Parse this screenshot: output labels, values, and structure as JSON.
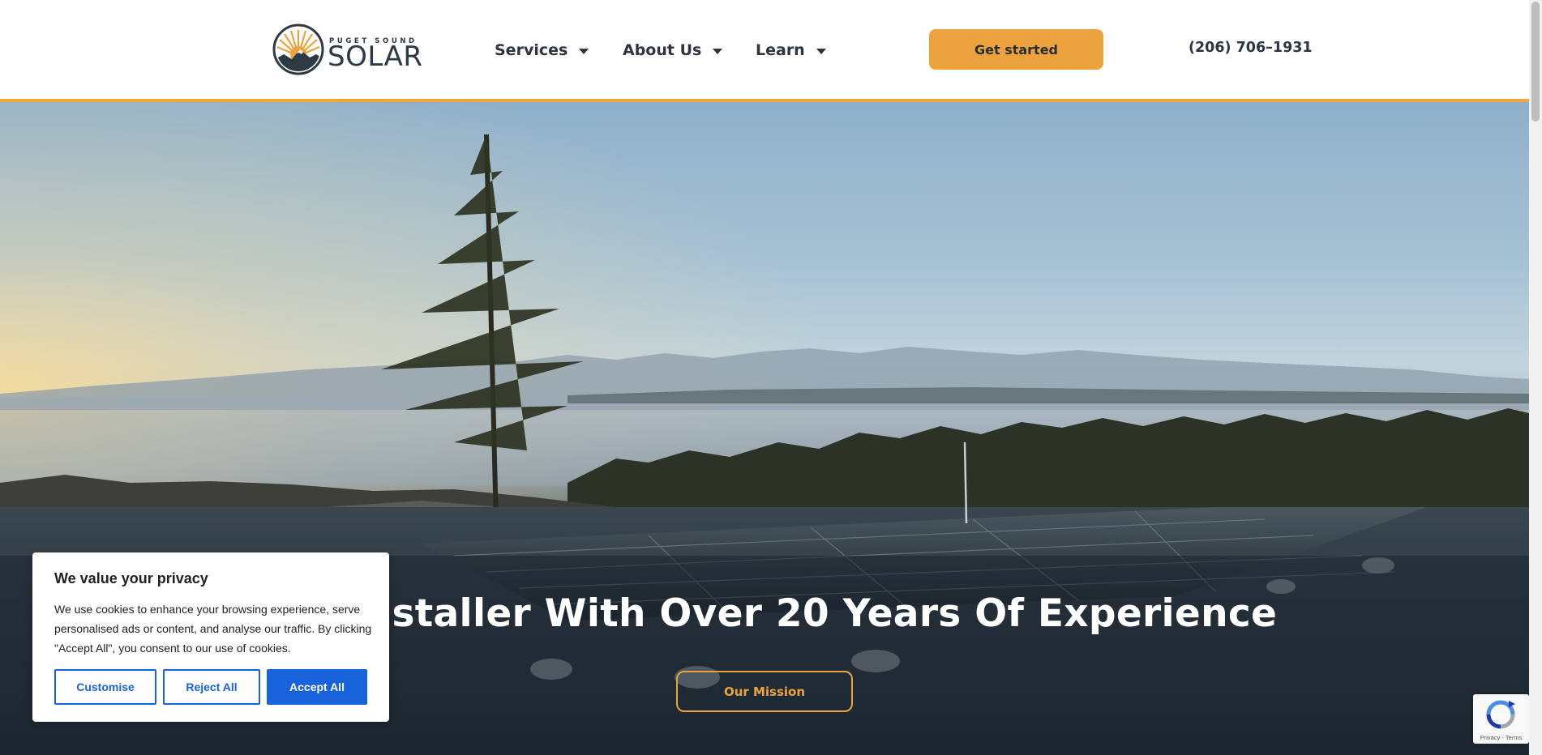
{
  "header": {
    "logo": {
      "small_text": "PUGET SOUND",
      "big_text": "SOLAR",
      "icon": "sun-mountain-logo-icon"
    },
    "nav": [
      {
        "label": "Services",
        "icon": "caret-down-icon"
      },
      {
        "label": "About Us",
        "icon": "caret-down-icon"
      },
      {
        "label": "Learn",
        "icon": "caret-down-icon"
      }
    ],
    "cta_label": "Get started",
    "phone": "(206) 706–1931"
  },
  "hero": {
    "title": "olar Installer With Over 20 Years Of Experience",
    "button_label": "Our Mission"
  },
  "cookie_banner": {
    "title": "We value your privacy",
    "text": "We use cookies to enhance your browsing experience, serve personalised ads or content, and analyse our traffic. By clicking \"Accept All\", you consent to our use of cookies.",
    "customise_label": "Customise",
    "reject_label": "Reject All",
    "accept_label": "Accept All"
  },
  "recaptcha": {
    "text": "Privacy - Terms",
    "icon": "recaptcha-icon"
  },
  "colors": {
    "accent": "#eda33d",
    "header_border": "#f0a73a",
    "nav_text": "#2d3540",
    "cookie_button": "#1863dc"
  }
}
